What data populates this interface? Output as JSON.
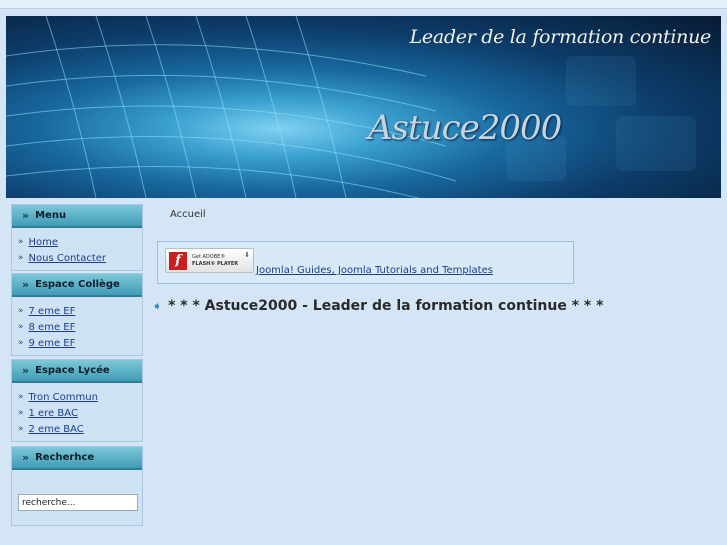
{
  "banner": {
    "tagline": "Leader de la formation continue",
    "logo": "Astuce2000"
  },
  "sidebar": {
    "menu": {
      "title": "Menu",
      "items": [
        {
          "label": "Home"
        },
        {
          "label": "Nous Contacter"
        }
      ]
    },
    "college": {
      "title": "Espace Collège",
      "items": [
        {
          "label": "7 eme EF"
        },
        {
          "label": "8 eme EF"
        },
        {
          "label": "9 eme EF"
        }
      ]
    },
    "lycee": {
      "title": "Espace Lycée",
      "items": [
        {
          "label": "Tron Commun"
        },
        {
          "label": "1 ere BAC"
        },
        {
          "label": "2 eme BAC"
        }
      ]
    },
    "search": {
      "title": "Recherhce",
      "placeholder": "recherche..."
    }
  },
  "main": {
    "breadcrumb": "Accueil",
    "flash_badge": {
      "line1": "Get ADOBE®",
      "line2": "FLASH® PLAYER"
    },
    "flash_link": "Joomla! Guides, Joomla Tutorials and Templates",
    "headline": "* * * Astuce2000 - Leader de la formation continue * * *"
  },
  "colors": {
    "accent": "#3f9cb7",
    "link": "#1d3f8a",
    "background": "#d4e6f5"
  }
}
